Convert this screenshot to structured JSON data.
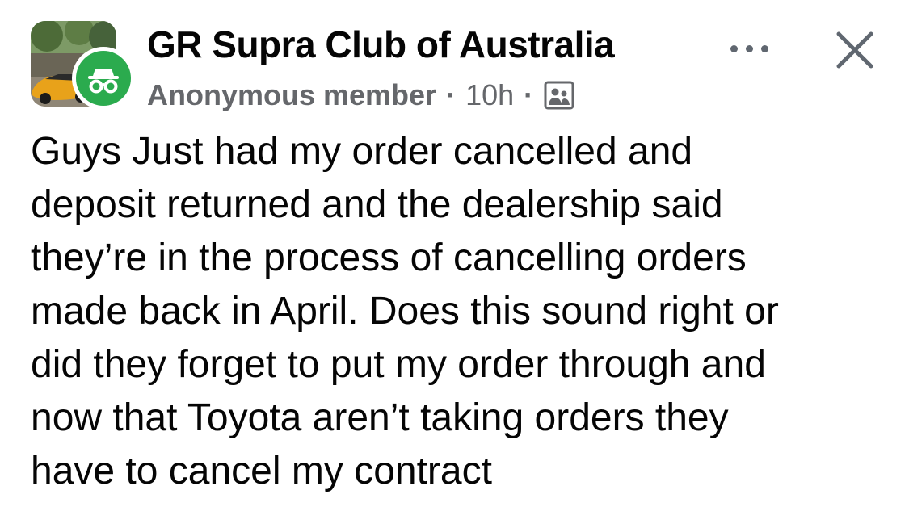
{
  "post": {
    "group_name": "GR Supra Club of Australia",
    "author": "Anonymous member",
    "separator": "·",
    "time": "10h",
    "audience_icon": "group-audience-icon",
    "body": "Guys Just had my order cancelled and\ndeposit returned and the dealership said\nthey’re in the process of cancelling orders\nmade back in April. Does this sound right or\ndid they forget to put my order through and\nnow that Toyota aren’t taking orders they\nhave to cancel my contract"
  },
  "icons": {
    "group_avatar": "group-avatar-image",
    "anonymous_badge": "incognito-icon",
    "more": "more-options-icon",
    "close": "close-icon"
  },
  "colors": {
    "text": "#050505",
    "secondary_text": "#65676b",
    "anonymous_badge": "#2bab4e",
    "icon": "#606770"
  }
}
